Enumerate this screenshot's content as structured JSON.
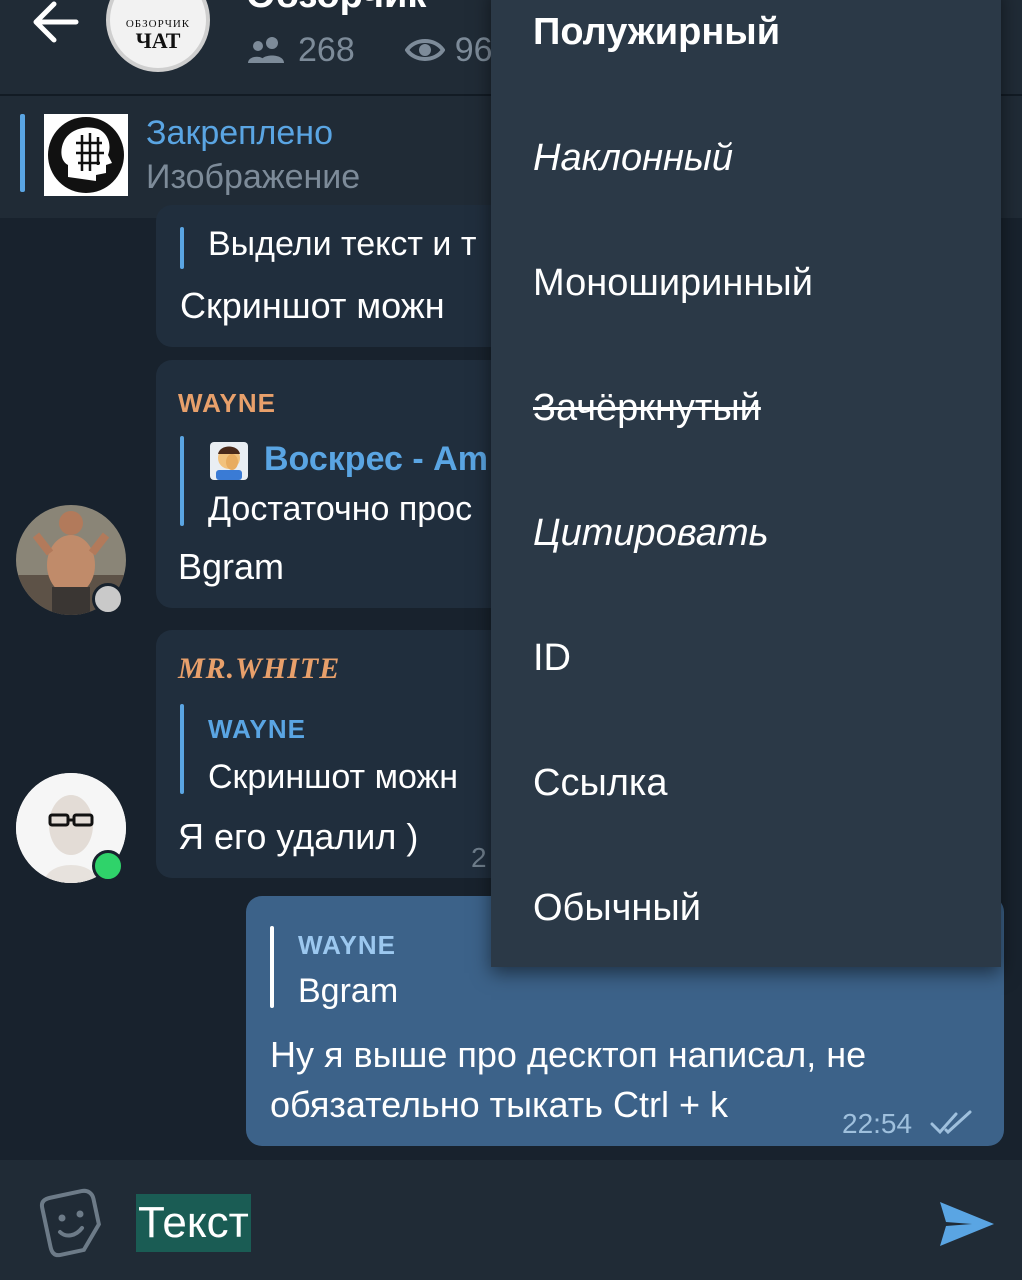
{
  "header": {
    "title": "Обзорчик",
    "members_count": "268",
    "views_count": "96",
    "avatar_small_text": "ОБЗОРЧИК",
    "avatar_big_text": "ЧАТ"
  },
  "pinned": {
    "title": "Закреплено",
    "subtitle": "Изображение"
  },
  "messages": [
    {
      "quote_text": "Выдели текст и т",
      "text": "Скриншот можн"
    },
    {
      "author": "WAYNE",
      "reply_title": "Воскрес - Am",
      "reply_text": "Достаточно прос",
      "text": "Bgram"
    },
    {
      "author": "MR.WHITE",
      "reply_author": "WAYNE",
      "reply_text": "Скриншот можн",
      "text": "Я его удалил )",
      "time_partial": "2"
    },
    {
      "reply_author": "WAYNE",
      "reply_text": "Bgram",
      "text_line1": "Ну я выше про десктоп написал, не",
      "text_line2": "обязательно тыкать Ctrl + k",
      "time": "22:54"
    }
  ],
  "composer": {
    "text": "Текст"
  },
  "context_menu": {
    "items": [
      {
        "label": "Полужирный"
      },
      {
        "label": "Наклонный"
      },
      {
        "label": "Моноширинный"
      },
      {
        "label": "Зачёркнутый"
      },
      {
        "label": "Цитировать"
      },
      {
        "label": "ID"
      },
      {
        "label": "Ссылка"
      },
      {
        "label": "Обычный"
      }
    ]
  },
  "colors": {
    "background": "#18222d",
    "header": "#202b36",
    "accent": "#5aa5e3",
    "outgoing_bubble": "#3c6289",
    "menu": "#2b3947",
    "selection": "#1a5c54",
    "online": "#2fd36a"
  }
}
